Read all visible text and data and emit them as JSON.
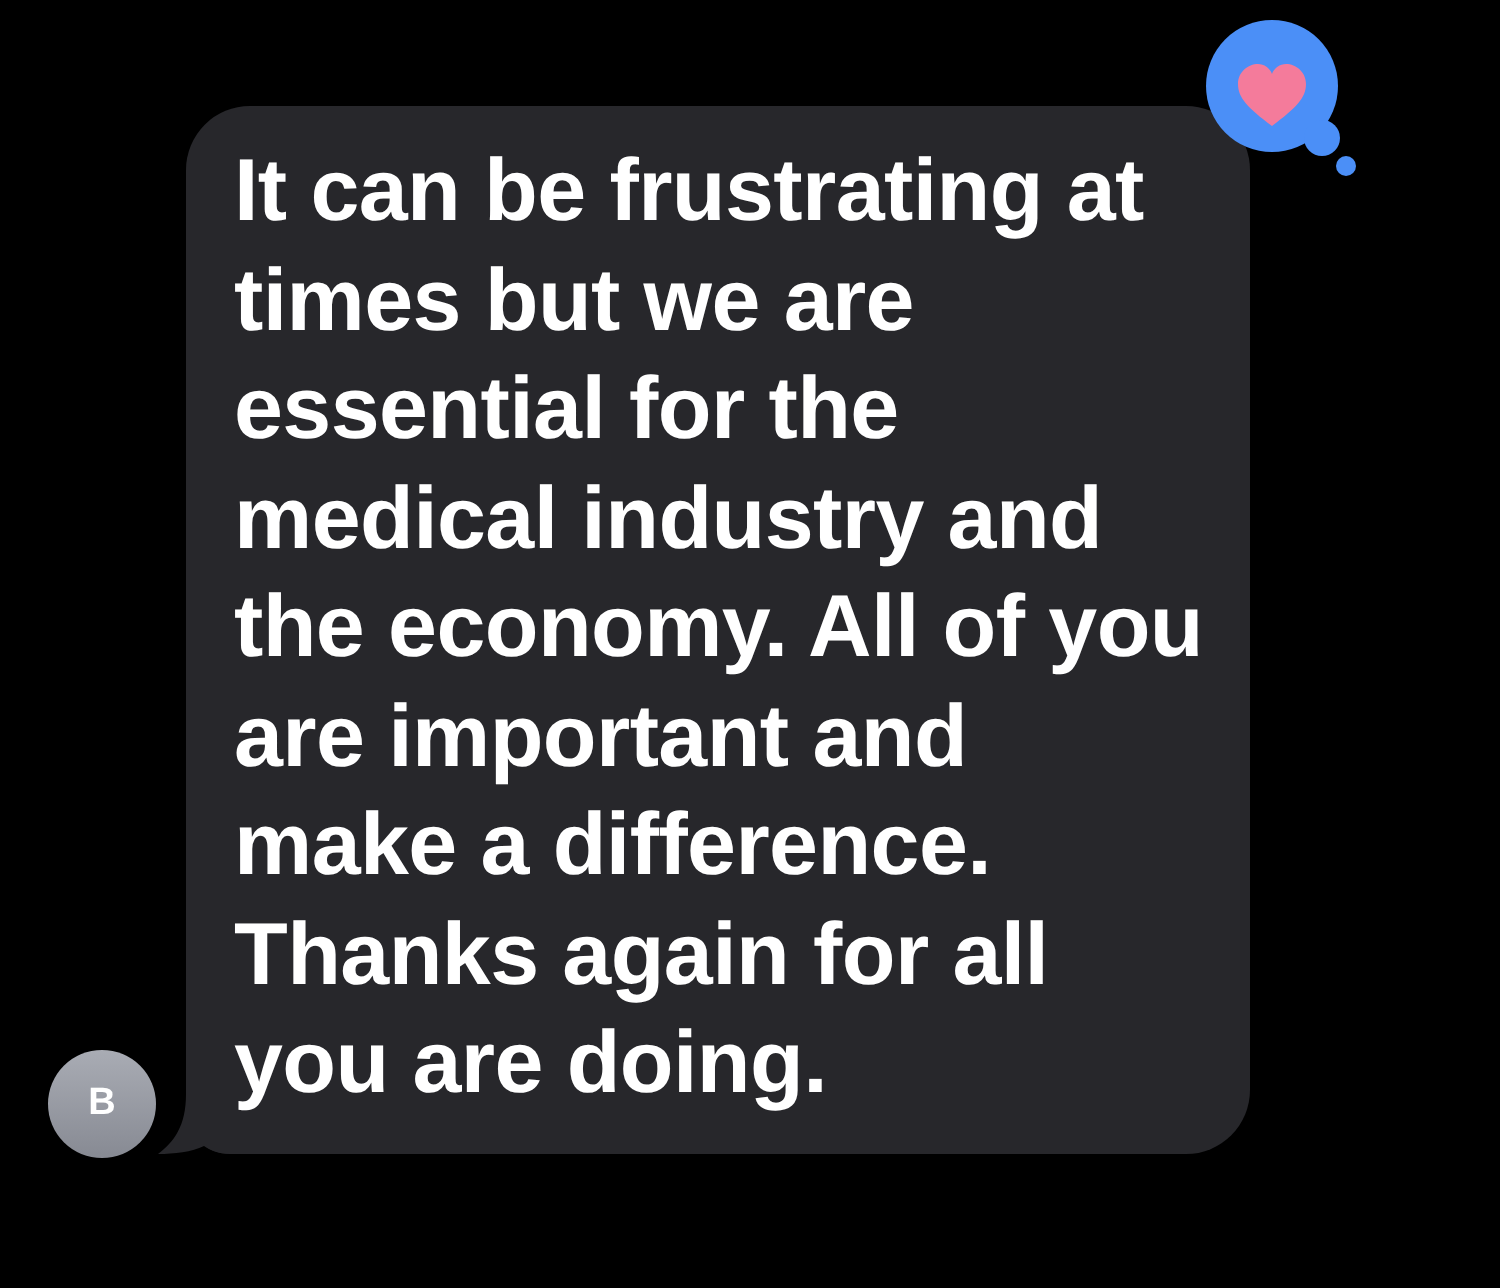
{
  "message": {
    "sender_initial": "B",
    "text": "It can be frustrating at times but we are essential for the medical industry and the economy. All of you are important and make a difference. Thanks again for all you are doing.",
    "reaction": {
      "kind": "heart"
    }
  }
}
